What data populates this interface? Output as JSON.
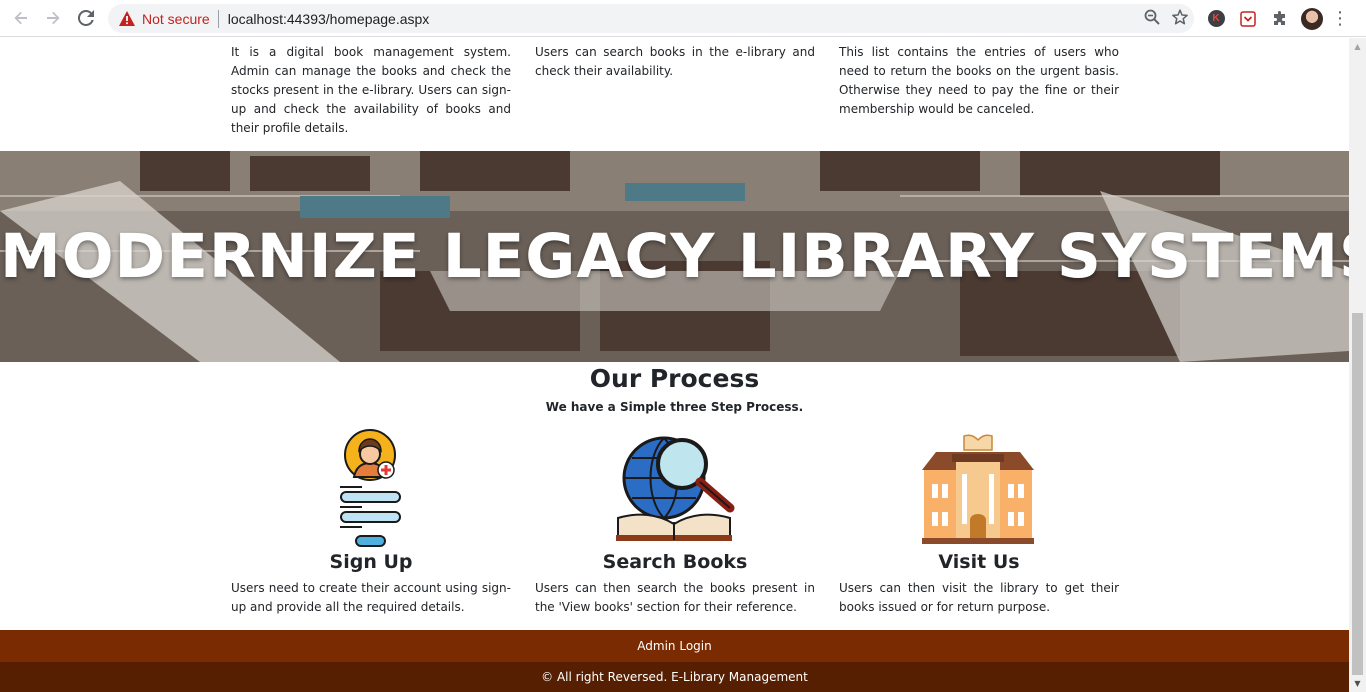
{
  "browser": {
    "not_secure_label": "Not secure",
    "url": "localhost:44393/homepage.aspx",
    "extension_badge": "K"
  },
  "features": [
    {
      "text": "It is a digital book management system. Admin can manage the books and check the stocks present in the e-library. Users can sign-up and check the availability of books and their profile details."
    },
    {
      "text": "Users can search books in the e-library and check their availability."
    },
    {
      "text": "This list contains the entries of users who need to return the books on the urgent basis. Otherwise they need to pay the fine or their membership would be canceled."
    }
  ],
  "banner": {
    "headline": "MODERNIZE LEGACY LIBRARY SYSTEMS"
  },
  "process": {
    "title": "Our Process",
    "subtitle": "We have a Simple three Step Process.",
    "steps": [
      {
        "icon": "sign-up-icon",
        "title": "Sign Up",
        "desc": "Users need to create their account using sign-up and provide all the required details."
      },
      {
        "icon": "search-books-icon",
        "title": "Search Books",
        "desc": "Users can then search the books present in the 'View books' section for their reference."
      },
      {
        "icon": "library-building-icon",
        "title": "Visit Us",
        "desc": "Users can then visit the library to get their books issued or for return purpose."
      }
    ]
  },
  "footer": {
    "admin_login": "Admin Login",
    "copyright": "© All right Reversed. E-Library Management"
  },
  "colors": {
    "footer_top": "#7a2b01",
    "footer_bottom": "#571f01",
    "not_secure": "#c5221f"
  }
}
